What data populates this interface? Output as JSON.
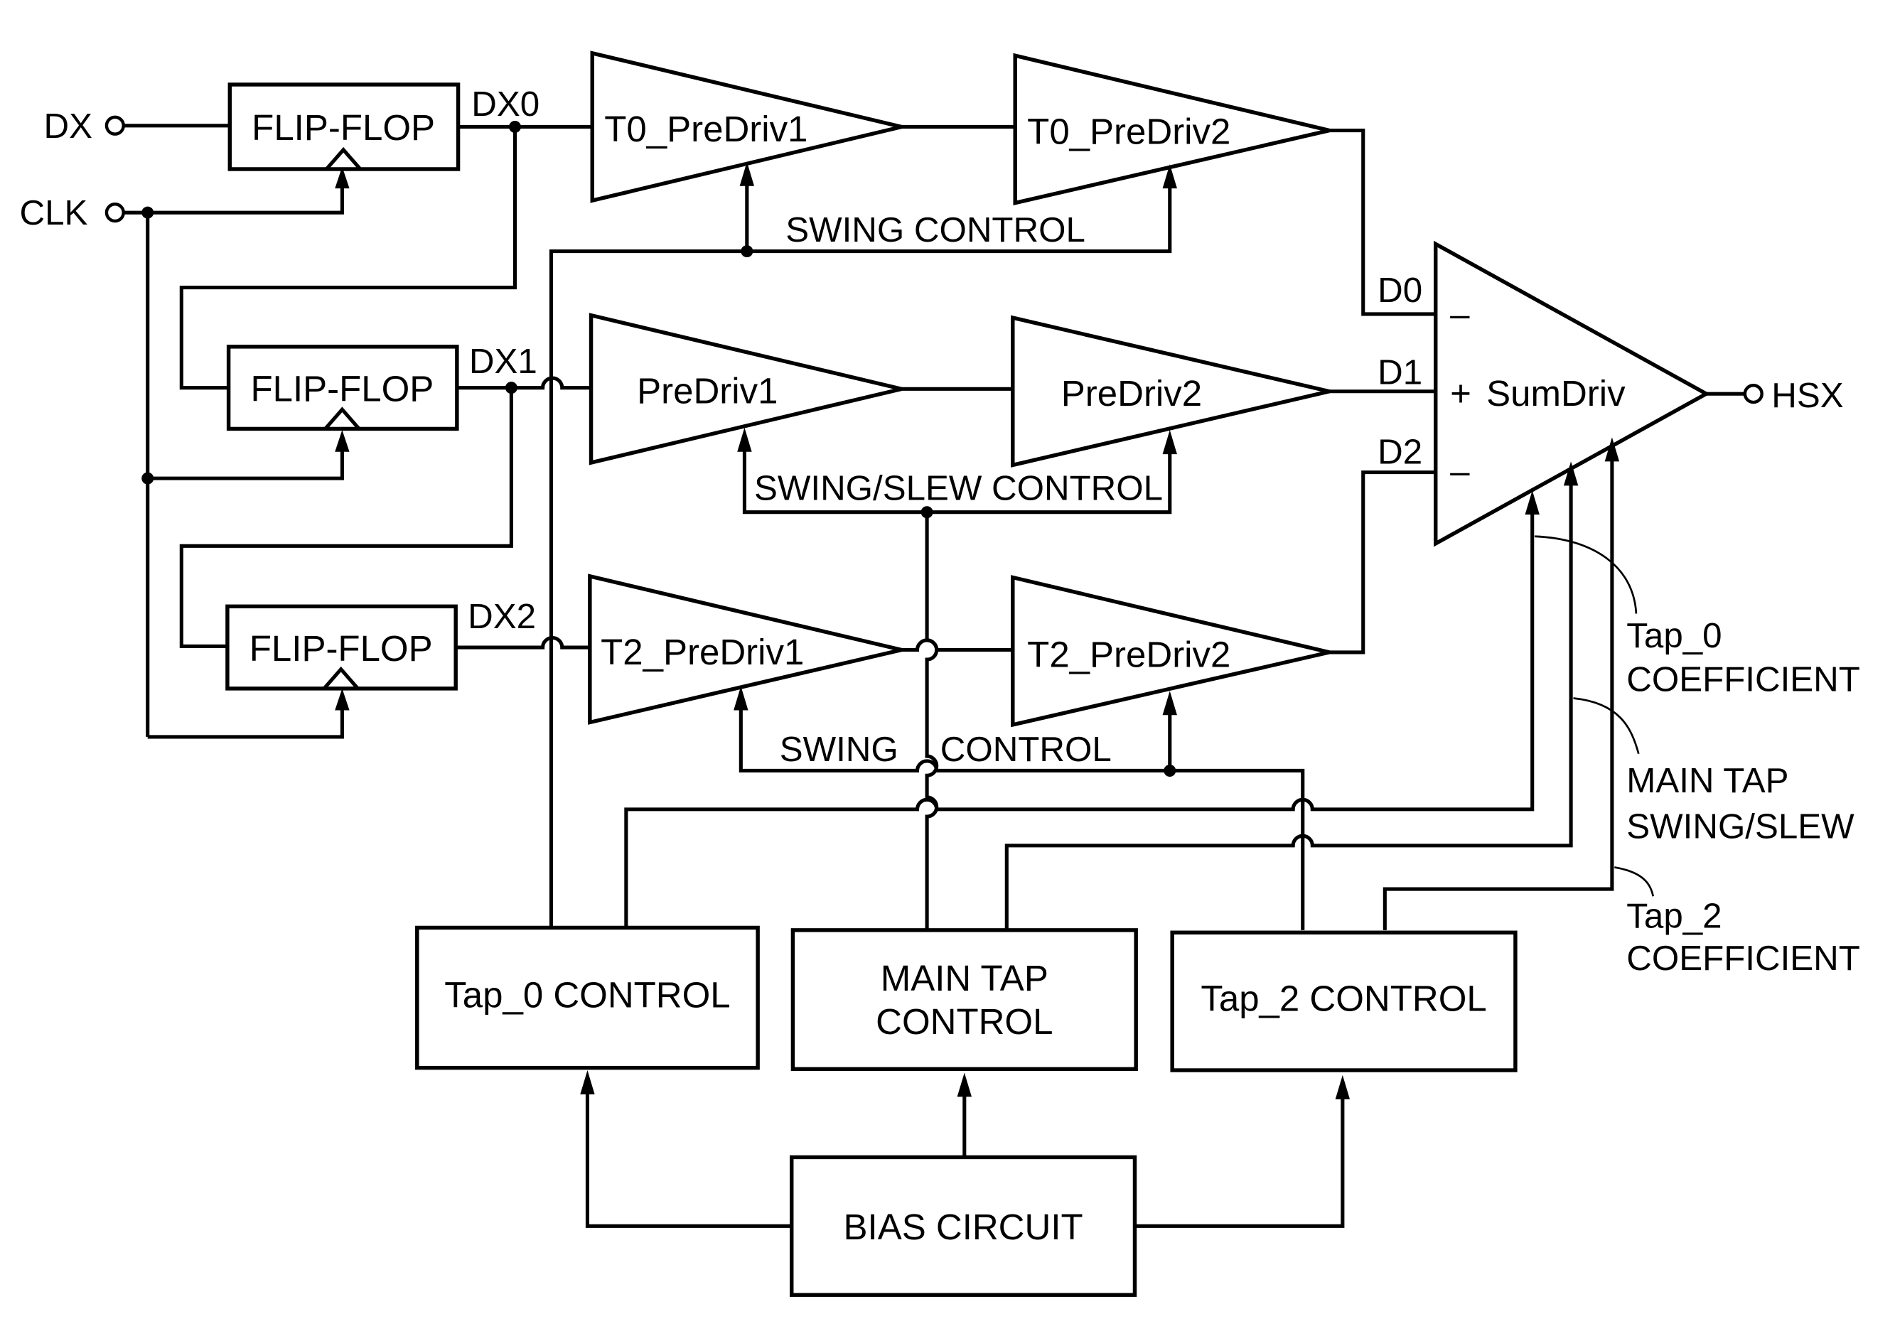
{
  "diagram": {
    "title": "",
    "inputs": {
      "dx": "DX",
      "clk": "CLK"
    },
    "output": "HSX",
    "flip_flops": [
      "FLIP-FLOP",
      "FLIP-FLOP",
      "FLIP-FLOP"
    ],
    "nets": {
      "dx0": "DX0",
      "dx1": "DX1",
      "dx2": "DX2",
      "d0": "D0",
      "d1": "D1",
      "d2": "D2"
    },
    "predrivers": {
      "t0_1": "T0_PreDriv1",
      "t0_2": "T0_PreDriv2",
      "main_1": "PreDriv1",
      "main_2": "PreDriv2",
      "t2_1": "T2_PreDriv1",
      "t2_2": "T2_PreDriv2"
    },
    "sum_driver": {
      "label": "SumDriv",
      "plus": "+",
      "minus_top": "–",
      "minus_bottom": "–"
    },
    "control_labels": {
      "t0_swing": "SWING CONTROL",
      "main_swing_slew": "SWING/SLEW CONTROL",
      "t2_swing_a": "SWING",
      "t2_swing_b": "CONTROL"
    },
    "control_blocks": {
      "tap0": "Tap_0 CONTROL",
      "main_line1": "MAIN TAP",
      "main_line2": "CONTROL",
      "tap2": "Tap_2  CONTROL",
      "bias": "BIAS CIRCUIT"
    },
    "annotations": {
      "tap0_line1": "Tap_0",
      "tap0_line2": "COEFFICIENT",
      "main_line1": "MAIN TAP",
      "main_line2": "SWING/SLEW",
      "tap2_line1": "Tap_2",
      "tap2_line2": "COEFFICIENT"
    }
  }
}
